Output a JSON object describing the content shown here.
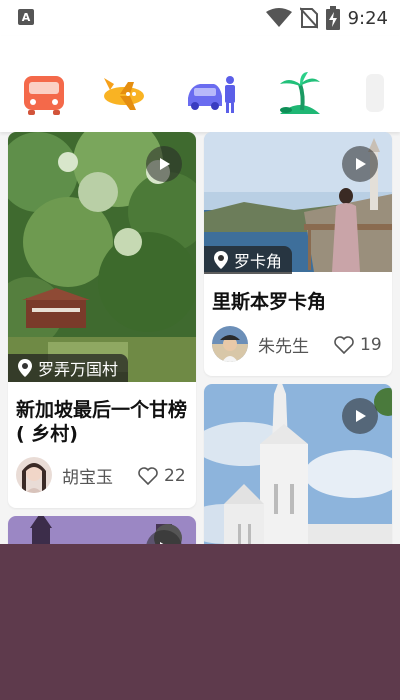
{
  "status_bar": {
    "time": "9:24",
    "icons": [
      "notification-a-icon",
      "wifi-icon",
      "no-sim-icon",
      "battery-charging-icon"
    ]
  },
  "categories": [
    {
      "icon": "bus-icon",
      "color": "#f4694a"
    },
    {
      "icon": "plane-icon",
      "color": "#f9b323"
    },
    {
      "icon": "car-rental-icon",
      "color": "#6a6cf0"
    },
    {
      "icon": "island-icon",
      "color": "#22c07a"
    }
  ],
  "feed": {
    "cards": [
      {
        "location": "罗弄万国村",
        "title": "新加坡最后一个甘榜 ( 乡村)",
        "author": "胡宝玉",
        "likes": "22"
      },
      {
        "location": "罗卡角",
        "title": "里斯本罗卡角",
        "author": "朱先生",
        "likes": "19"
      },
      {
        "location": "",
        "title": "",
        "author": "",
        "likes": ""
      },
      {
        "location": "",
        "title": "",
        "author": "",
        "likes": ""
      }
    ]
  },
  "colors": {
    "bottom_block": "#5e3a4c",
    "tag_bg": "#1e1e1e"
  }
}
